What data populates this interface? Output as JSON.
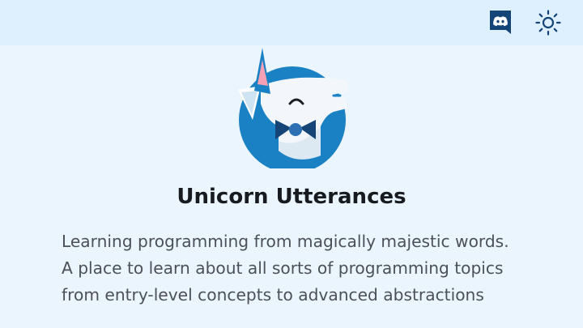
{
  "header": {
    "discord_icon": "discord-icon",
    "theme_icon": "sun-icon"
  },
  "logo": {
    "icon": "unicorn-logo"
  },
  "main": {
    "title": "Unicorn Utterances",
    "description": "Learning programming from magically majestic words. A place to learn about all sorts of programming topics from entry-level concepts to advanced abstractions"
  },
  "colors": {
    "page_background": "#ebf5fe",
    "header_background": "#deeffd",
    "brand_dark": "#154477",
    "brand_blue": "#1a82c4",
    "horn_pink": "#f4a1b6"
  }
}
